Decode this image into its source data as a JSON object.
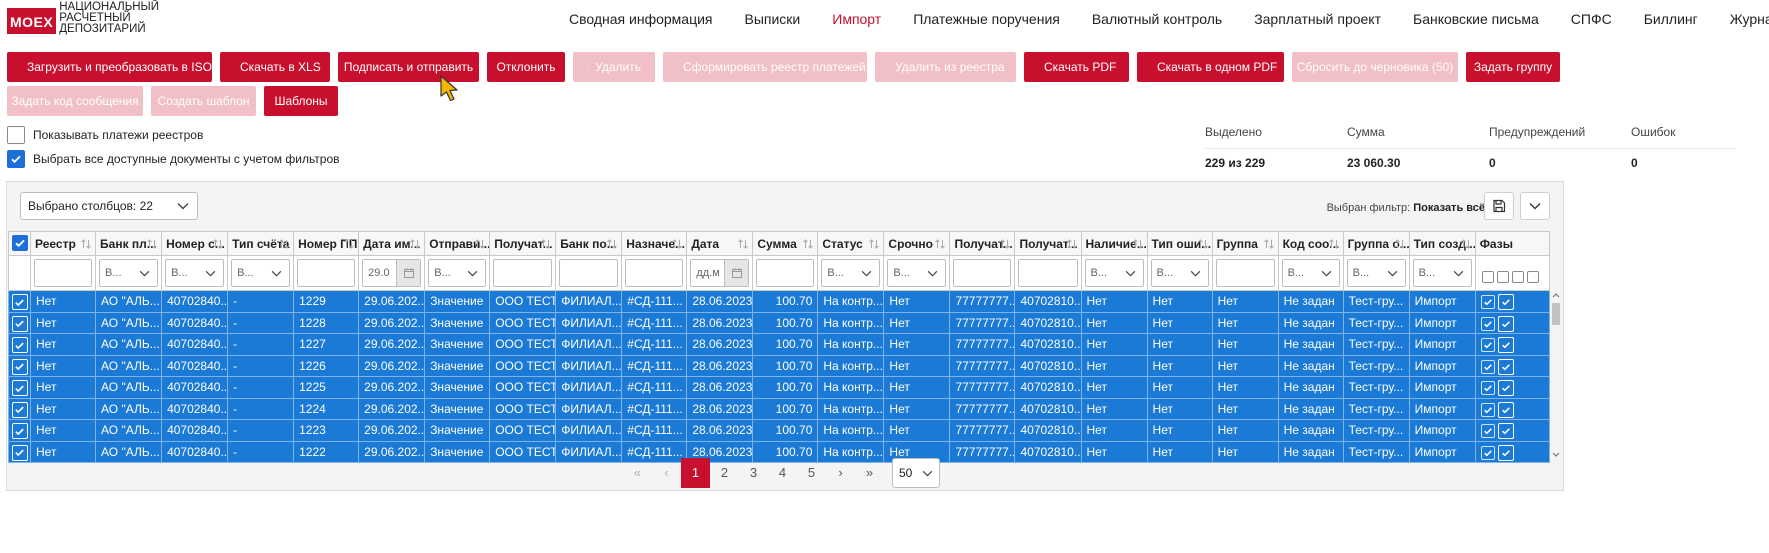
{
  "logo": {
    "mark": "MOEX",
    "line1": "НАЦИОНАЛЬНЫЙ",
    "line2": "РАСЧЕТНЫЙ",
    "line3": "ДЕПОЗИТАРИЙ"
  },
  "nav": [
    "Сводная информация",
    "Выписки",
    "Импорт",
    "Платежные поручения",
    "Валютный контроль",
    "Зарплатный проект",
    "Банковские письма",
    "СПФС",
    "Биллинг",
    "Журнал"
  ],
  "nav_active": "Импорт",
  "toolbar": {
    "upload_iso": "Загрузить и преобразовать в ISO",
    "download_xls": "Скачать в XLS",
    "sign_send": "Подписать и отправить",
    "reject": "Отклонить",
    "delete": "Удалить",
    "form_registry": "Сформировать реестр платежей",
    "remove_registry": "Удалить из реестра",
    "download_pdf": "Скачать PDF",
    "download_one_pdf": "Скачать в одном PDF",
    "reset_draft": "Сбросить до черновика (50)",
    "set_group": "Задать группу",
    "set_msg_code": "Задать код сообщения",
    "create_template": "Создать шаблон",
    "templates": "Шаблоны"
  },
  "options": {
    "show_registry": "Показывать платежи реестров",
    "select_all": "Выбрать все доступные документы с учетом фильтров"
  },
  "summary": {
    "headers": [
      "Выделено",
      "Сумма",
      "Предупреждений",
      "Ошибок"
    ],
    "values": [
      "229 из 229",
      "23 060.30",
      "0",
      "0"
    ]
  },
  "grid": {
    "columns_selected": "Выбрано столбцов: 22",
    "filter_label": "Выбран фильтр:",
    "filter_value": "Показать всё",
    "headers": [
      "Реестр",
      "Банк пл...",
      "Номер с...",
      "Тип счёта",
      "Номер ПП",
      "Дата им...",
      "Отправи...",
      "Получат...",
      "Банк по...",
      "Назначе...",
      "Дата",
      "Сумма",
      "Статус",
      "Срочно",
      "Получат...",
      "Получат...",
      "Наличие...",
      "Тип оши...",
      "Группа",
      "Код соо...",
      "Группа о...",
      "Тип созд...",
      "Фазы"
    ],
    "filters": [
      "",
      "В...",
      "В...",
      "В...",
      "",
      "29.0",
      "В...",
      "",
      "",
      "",
      "дд.м",
      "",
      "В...",
      "В...",
      "",
      "",
      "В...",
      "В...",
      "",
      "В...",
      "В...",
      "В...",
      ""
    ],
    "rows": [
      [
        "Нет",
        "АО \"АЛЬ...",
        "40702840...",
        "-",
        "1229",
        "29.06.202...",
        "Значение",
        "ООО ТЕСТ",
        "ФИЛИАЛ...",
        "#СД-111...",
        "28.06.2023",
        "100.70",
        "На контр...",
        "Нет",
        "77777777...",
        "40702810...",
        "Нет",
        "Нет",
        "Нет",
        "Не задан",
        "Тест-гру...",
        "Импорт"
      ],
      [
        "Нет",
        "АО \"АЛЬ...",
        "40702840...",
        "-",
        "1228",
        "29.06.202...",
        "Значение",
        "ООО ТЕСТ",
        "ФИЛИАЛ...",
        "#СД-111...",
        "28.06.2023",
        "100.70",
        "На контр...",
        "Нет",
        "77777777...",
        "40702810...",
        "Нет",
        "Нет",
        "Нет",
        "Не задан",
        "Тест-гру...",
        "Импорт"
      ],
      [
        "Нет",
        "АО \"АЛЬ...",
        "40702840...",
        "-",
        "1227",
        "29.06.202...",
        "Значение",
        "ООО ТЕСТ",
        "ФИЛИАЛ...",
        "#СД-111...",
        "28.06.2023",
        "100.70",
        "На контр...",
        "Нет",
        "77777777...",
        "40702810...",
        "Нет",
        "Нет",
        "Нет",
        "Не задан",
        "Тест-гру...",
        "Импорт"
      ],
      [
        "Нет",
        "АО \"АЛЬ...",
        "40702840...",
        "-",
        "1226",
        "29.06.202...",
        "Значение",
        "ООО ТЕСТ",
        "ФИЛИАЛ...",
        "#СД-111...",
        "28.06.2023",
        "100.70",
        "На контр...",
        "Нет",
        "77777777...",
        "40702810...",
        "Нет",
        "Нет",
        "Нет",
        "Не задан",
        "Тест-гру...",
        "Импорт"
      ],
      [
        "Нет",
        "АО \"АЛЬ...",
        "40702840...",
        "-",
        "1225",
        "29.06.202...",
        "Значение",
        "ООО ТЕСТ",
        "ФИЛИАЛ...",
        "#СД-111...",
        "28.06.2023",
        "100.70",
        "На контр...",
        "Нет",
        "77777777...",
        "40702810...",
        "Нет",
        "Нет",
        "Нет",
        "Не задан",
        "Тест-гру...",
        "Импорт"
      ],
      [
        "Нет",
        "АО \"АЛЬ...",
        "40702840...",
        "-",
        "1224",
        "29.06.202...",
        "Значение",
        "ООО ТЕСТ",
        "ФИЛИАЛ...",
        "#СД-111...",
        "28.06.2023",
        "100.70",
        "На контр...",
        "Нет",
        "77777777...",
        "40702810...",
        "Нет",
        "Нет",
        "Нет",
        "Не задан",
        "Тест-гру...",
        "Импорт"
      ],
      [
        "Нет",
        "АО \"АЛЬ...",
        "40702840...",
        "-",
        "1223",
        "29.06.202...",
        "Значение",
        "ООО ТЕСТ",
        "ФИЛИАЛ...",
        "#СД-111...",
        "28.06.2023",
        "100.70",
        "На контр...",
        "Нет",
        "77777777...",
        "40702810...",
        "Нет",
        "Нет",
        "Нет",
        "Не задан",
        "Тест-гру...",
        "Импорт"
      ],
      [
        "Нет",
        "АО \"АЛЬ...",
        "40702840...",
        "-",
        "1222",
        "29.06.202...",
        "Значение",
        "ООО ТЕСТ",
        "ФИЛИАЛ...",
        "#СД-111...",
        "28.06.2023",
        "100.70",
        "На контр...",
        "Нет",
        "77777777...",
        "40702810...",
        "Нет",
        "Нет",
        "Нет",
        "Не задан",
        "Тест-гру...",
        "Импорт"
      ]
    ]
  },
  "pagination": {
    "pages": [
      "1",
      "2",
      "3",
      "4",
      "5"
    ],
    "current": "1",
    "page_size": "50"
  },
  "colors": {
    "accent": "#c8102e",
    "accent_disabled": "#f1bfc6",
    "selection": "#1a7ad6"
  }
}
